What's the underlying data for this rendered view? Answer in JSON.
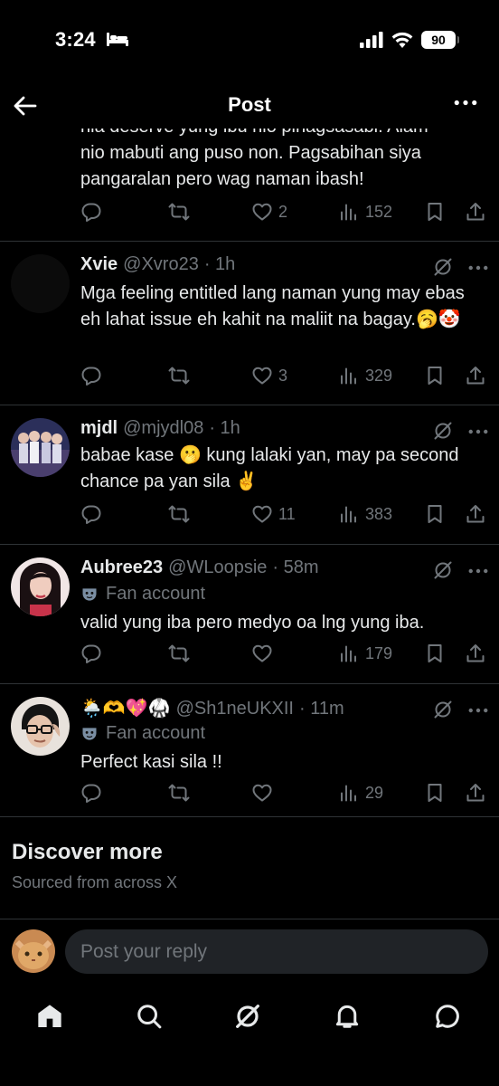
{
  "status_bar": {
    "time": "3:24",
    "battery": "90"
  },
  "header": {
    "title": "Post"
  },
  "clipped_reply": {
    "line_partial": "nia deserve yung ibu nio pinagsasabi. Alam",
    "text": "nio mabuti ang puso non. Pagsabihan siya pangaralan pero wag naman ibash!",
    "likes": "2",
    "views": "152"
  },
  "replies": [
    {
      "name": "Xvie",
      "handle": "@Xvro23",
      "time": "· 1h",
      "text": "Mga feeling entitled lang naman yung may ebas eh lahat issue eh kahit na maliit na bagay.🥱🤡",
      "likes": "3",
      "views": "329"
    },
    {
      "name": "mjdl",
      "handle": "@mjydl08",
      "time": "· 1h",
      "text": "babae kase 🫢 kung lalaki yan, may pa second chance pa yan sila ✌️",
      "likes": "11",
      "views": "383"
    },
    {
      "name": "Aubree23",
      "handle": "@WLoopsie",
      "time": "· 58m",
      "badge": "Fan account",
      "text": "valid yung iba pero medyo oa lng yung iba.",
      "likes": "",
      "views": "179"
    },
    {
      "name": "🌦️🫶💖🥋",
      "handle": "@Sh1neUKXII",
      "time": "· 11m",
      "badge": "Fan account",
      "text": "Perfect kasi sila  !!",
      "likes": "",
      "views": "29"
    }
  ],
  "discover": {
    "title": "Discover more",
    "subtitle": "Sourced from across X"
  },
  "reply_bar": {
    "placeholder": "Post your reply"
  },
  "nav": {
    "items": [
      "home-icon",
      "search-icon",
      "grok-icon",
      "bell-icon",
      "messages-icon"
    ]
  },
  "colors": {
    "background": "#000000",
    "text": "#e7e9ea",
    "muted": "#71767b",
    "divider": "#2f3336",
    "input": "#202327"
  }
}
